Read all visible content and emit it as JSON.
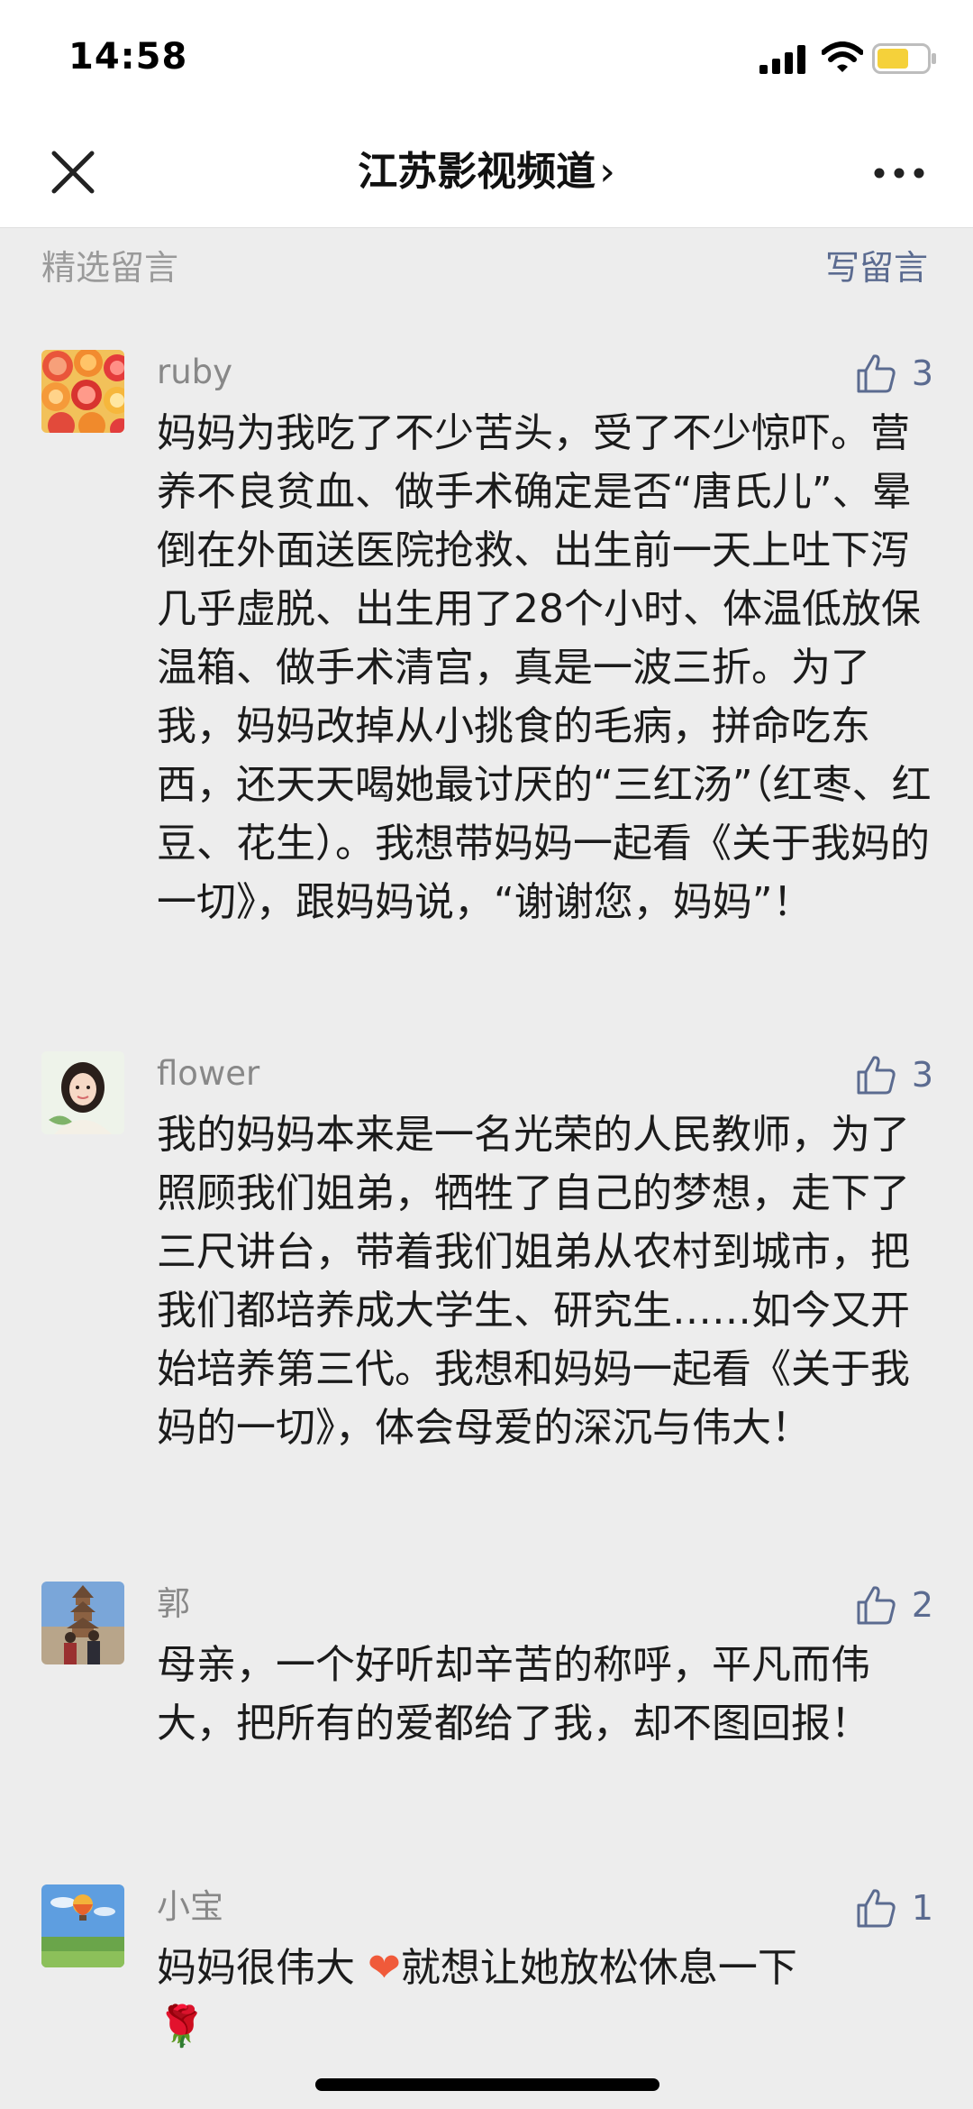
{
  "status_bar": {
    "time": "14:58"
  },
  "nav": {
    "title": "江苏影视频道",
    "chevron": "›"
  },
  "section": {
    "title": "精选留言",
    "write_label": "写留言"
  },
  "comments": [
    {
      "username": "ruby",
      "likes": "3",
      "text": "妈妈为我吃了不少苦头，受了不少惊吓。营养不良贫血、做手术确定是否“唐氏儿”、晕倒在外面送医院抢救、出生前一天上吐下泻几乎虚脱、出生用了28个小时、体温低放保温箱、做手术清宫，真是一波三折。为了我，妈妈改掉从小挑食的毛病，拼命吃东西，还天天喝她最讨厌的“三红汤”（红枣、红豆、花生）。我想带妈妈一起看《关于我妈的一切》，跟妈妈说，“谢谢您，妈妈”！"
    },
    {
      "username": "flower",
      "likes": "3",
      "text": "我的妈妈本来是一名光荣的人民教师，为了照顾我们姐弟，牺牲了自己的梦想，走下了三尺讲台，带着我们姐弟从农村到城市，把我们都培养成大学生、研究生……如今又开始培养第三代。我想和妈妈一起看《关于我妈的一切》，体会母爱的深沉与伟大！"
    },
    {
      "username": "郭",
      "likes": "2",
      "text": "母亲，一个好听却辛苦的称呼，平凡而伟大，把所有的爱都给了我，却不图回报！"
    },
    {
      "username": "小宝",
      "likes": "1",
      "text_before": "妈妈很伟大 ",
      "emoji_heart": "❤",
      "text_after": "就想让她放松休息一下",
      "emoji_rose": "🌹"
    }
  ],
  "colors": {
    "background": "#ededed",
    "link": "#5b6b90",
    "muted": "#888888",
    "heart": "#f05a3a",
    "battery": "#f5d13a"
  }
}
